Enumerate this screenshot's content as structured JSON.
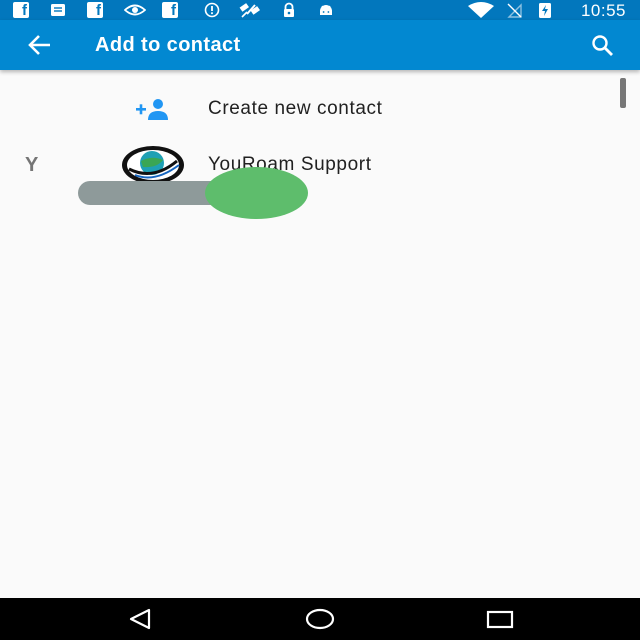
{
  "status_bar": {
    "time": "10:55",
    "left_icons": [
      "facebook-icon",
      "message-icon",
      "facebook-icon",
      "eye-icon",
      "facebook-icon",
      "alert-icon",
      "satellite-icon",
      "lock-icon",
      "android-icon"
    ],
    "right_icons": [
      "wifi-icon",
      "no-sim-icon",
      "battery-charging-icon"
    ]
  },
  "app_bar": {
    "title": "Add to contact",
    "back_icon": "arrow-back-icon",
    "search_icon": "search-icon"
  },
  "list": {
    "create_item": {
      "label": "Create new contact",
      "icon": "add-person-icon"
    },
    "sections": [
      {
        "letter": "Y",
        "contacts": [
          {
            "name": "YouRoam Support",
            "avatar": "youroam-logo"
          }
        ]
      }
    ]
  },
  "nav_bar": {
    "buttons": [
      "back-triangle-icon",
      "home-circle-icon",
      "recents-square-icon"
    ]
  },
  "colors": {
    "status_bar": "#0277bd",
    "app_bar": "#0288d1",
    "background": "#fafafa",
    "accent_icon": "#2196f3",
    "section_letter": "#757575",
    "text_primary": "#212121",
    "swipe_track": "#8e9a9a",
    "swipe_dot": "#5ebd6c",
    "nav_bar": "#000000"
  }
}
